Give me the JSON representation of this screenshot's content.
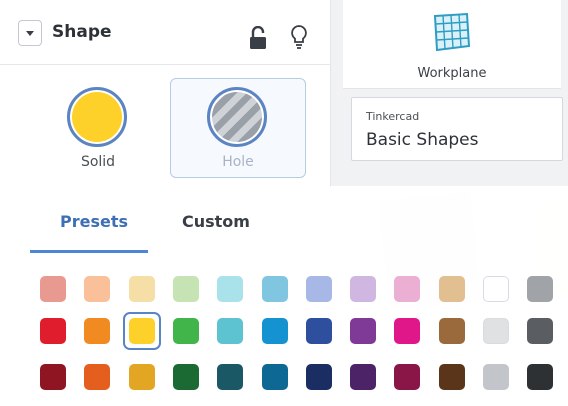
{
  "shape_panel": {
    "title": "Shape",
    "solid_label": "Solid",
    "hole_label": "Hole",
    "solid_color": "#fdd12a",
    "icons": [
      "chevron-down-icon",
      "lock-open-icon",
      "lightbulb-icon"
    ]
  },
  "workplane": {
    "label": "Workplane",
    "icon": "workplane-grid-icon"
  },
  "library": {
    "caption": "Tinkercad",
    "value": "Basic Shapes"
  },
  "color_picker": {
    "tabs": [
      "Presets",
      "Custom"
    ],
    "active_tab": "Presets",
    "selected_color": "#fdd12a",
    "accent_color": "#4d86d3",
    "rows": [
      [
        "#e89a91",
        "#f9c09a",
        "#f6dfa6",
        "#c6e3b3",
        "#a9e2ea",
        "#80c6e0",
        "#a7b7e6",
        "#cfb7e2",
        "#ebafd4",
        "#e2bf90",
        "#ffffff",
        "#a0a4a8"
      ],
      [
        "#e01d2c",
        "#f28a22",
        "#fdd12a",
        "#41b54a",
        "#5ec3d1",
        "#1593d1",
        "#2d4f9e",
        "#7f3a97",
        "#e01789",
        "#9a6a3c",
        "#dfe1e3",
        "#5a5e62"
      ],
      [
        "#8f1522",
        "#e45f1e",
        "#e3a622",
        "#1c6a33",
        "#1a5866",
        "#0d6894",
        "#1b2e63",
        "#4c2366",
        "#8a1547",
        "#5a351a",
        "#c2c6cb",
        "#2e3134"
      ]
    ]
  }
}
